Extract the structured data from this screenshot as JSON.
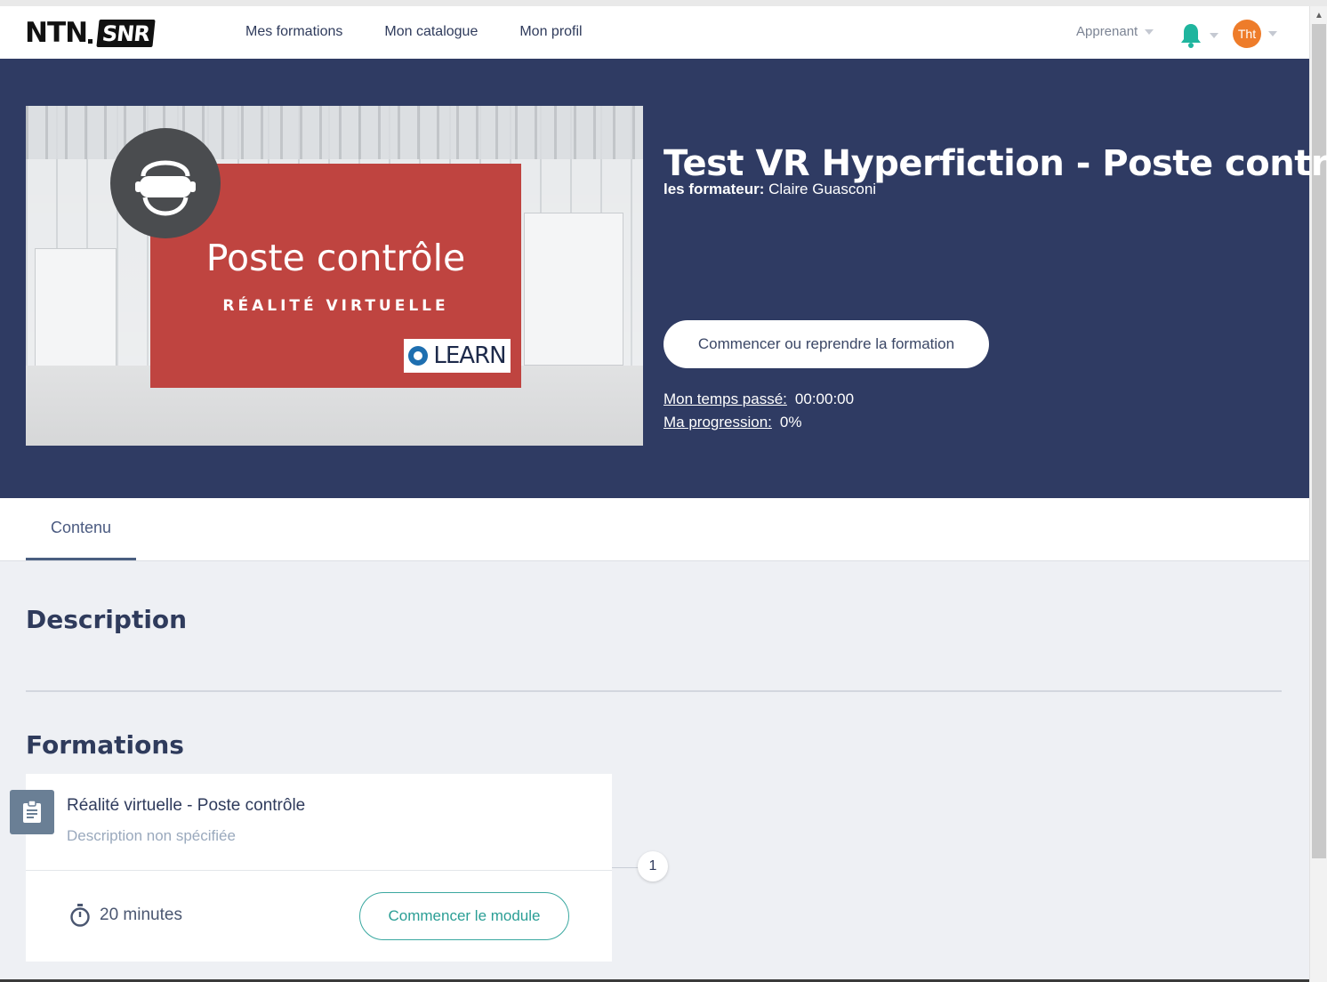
{
  "header": {
    "logo_text_1": "NTN",
    "logo_text_2": "SNR",
    "nav": [
      "Mes formations",
      "Mon catalogue",
      "Mon profil"
    ],
    "role": "Apprenant",
    "avatar_initials": "Tht",
    "icons": [
      "bell-icon",
      "chevron-down-icon",
      "user-avatar"
    ],
    "colors": {
      "bell": "#1fb59e",
      "avatar": "#ee7c2a"
    }
  },
  "hero": {
    "image": {
      "title": "Poste contrôle",
      "subtitle": "RÉALITÉ VIRTUELLE",
      "badge": "LEARN",
      "icon": "vr-headset-icon"
    },
    "title": "Test VR Hyperfiction - Poste contrôle",
    "trainer_label": "les formateur:",
    "trainer_name": "Claire Guasconi",
    "start_button": "Commencer ou reprendre la formation",
    "time_label": "Mon temps passé:",
    "time_value": "00:00:00",
    "progress_label": "Ma progression:",
    "progress_value": "0%",
    "colors": {
      "background": "#2f3b63",
      "image_card": "#bf4440"
    }
  },
  "tabs": [
    "Contenu"
  ],
  "main": {
    "description_heading": "Description",
    "formations_heading": "Formations",
    "modules": [
      {
        "title": "Réalité virtuelle - Poste contrôle",
        "description": "Description non spécifiée",
        "duration": "20 minutes",
        "button": "Commencer le module",
        "step": "1",
        "icon": "clipboard-icon",
        "duration_icon": "stopwatch-icon"
      }
    ],
    "colors": {
      "module_button": "#2a9e95"
    }
  }
}
